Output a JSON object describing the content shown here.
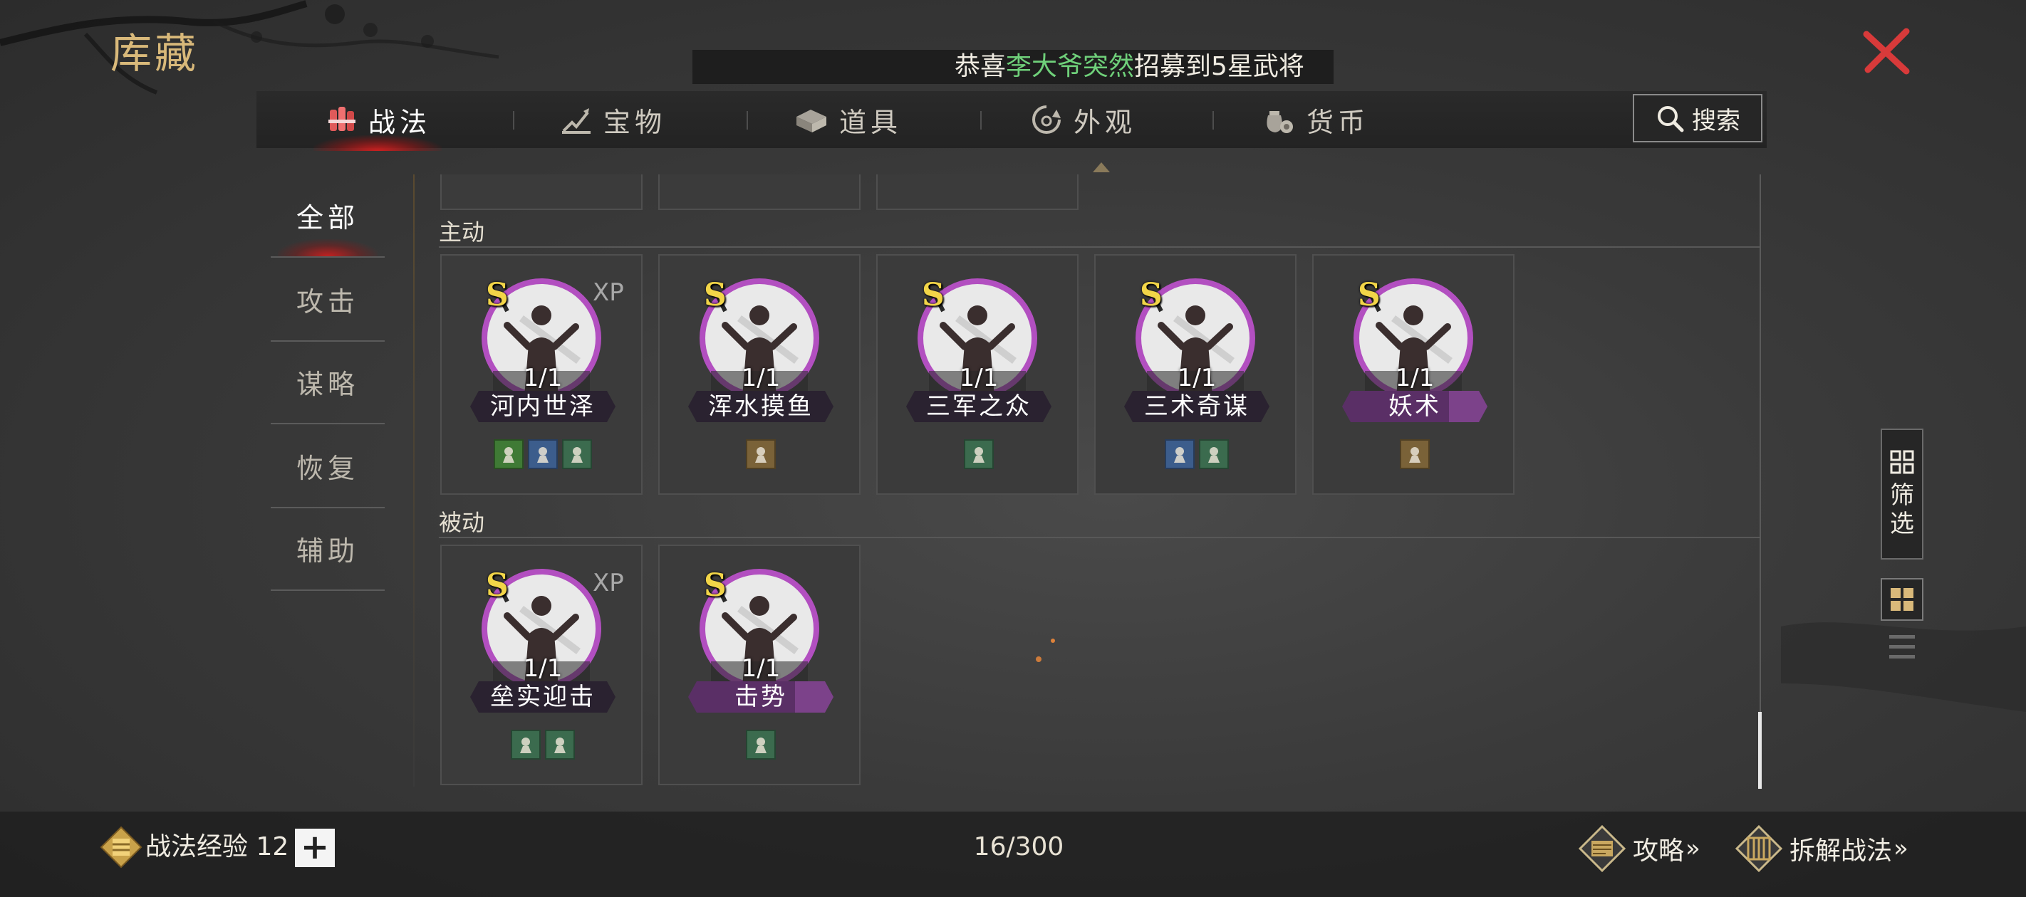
{
  "header": {
    "title": "库藏",
    "close_icon": "close-icon"
  },
  "marquee": {
    "prefix": "恭喜",
    "highlight": "李大爷突然",
    "suffix": "招募到5星武将"
  },
  "tabs": [
    {
      "label": "战法",
      "icon": "scroll-bundle-icon",
      "active": true
    },
    {
      "label": "宝物",
      "icon": "treasure-icon",
      "active": false
    },
    {
      "label": "道具",
      "icon": "item-box-icon",
      "active": false
    },
    {
      "label": "外观",
      "icon": "appearance-icon",
      "active": false
    },
    {
      "label": "货币",
      "icon": "coin-bag-icon",
      "active": false
    }
  ],
  "search": {
    "label": "搜索"
  },
  "side_menu": [
    {
      "label": "全部",
      "active": true
    },
    {
      "label": "攻击",
      "active": false
    },
    {
      "label": "谋略",
      "active": false
    },
    {
      "label": "恢复",
      "active": false
    },
    {
      "label": "辅助",
      "active": false
    }
  ],
  "sections": [
    {
      "label": "主动",
      "cards": [
        {
          "grade": "S",
          "xp": "XP",
          "count": "1/1",
          "name": "河内世泽",
          "name_style": "dark",
          "badges": [
            "green",
            "blue",
            "teal"
          ]
        },
        {
          "grade": "S",
          "xp": "",
          "count": "1/1",
          "name": "浑水摸鱼",
          "name_style": "dark",
          "badges": [
            "brown"
          ]
        },
        {
          "grade": "S",
          "xp": "",
          "count": "1/1",
          "name": "三军之众",
          "name_style": "dark",
          "badges": [
            "teal"
          ]
        },
        {
          "grade": "S",
          "xp": "",
          "count": "1/1",
          "name": "三术奇谋",
          "name_style": "dark",
          "badges": [
            "blue",
            "teal"
          ]
        },
        {
          "grade": "S",
          "xp": "",
          "count": "1/1",
          "name": "妖术",
          "name_style": "purple",
          "badges": [
            "brown"
          ]
        }
      ]
    },
    {
      "label": "被动",
      "cards": [
        {
          "grade": "S",
          "xp": "XP",
          "count": "1/1",
          "name": "垒实迎击",
          "name_style": "dark",
          "badges": [
            "teal",
            "teal"
          ]
        },
        {
          "grade": "S",
          "xp": "",
          "count": "1/1",
          "name": "击势",
          "name_style": "purple",
          "badges": [
            "teal"
          ]
        }
      ]
    }
  ],
  "filter": {
    "label": "筛选"
  },
  "bottom": {
    "exp_label": "战法经验 12",
    "plus": "+",
    "page_count": "16/300",
    "guide_label": "攻略",
    "disband_label": "拆解战法",
    "arrow": "»"
  },
  "colors": {
    "accent_gold": "#d9b97a",
    "tab_active_glow": "#d21e1e",
    "marquee_highlight": "#6fd07a",
    "grade_gold": "#f2d548",
    "portrait_ring": "#b24fc0"
  }
}
